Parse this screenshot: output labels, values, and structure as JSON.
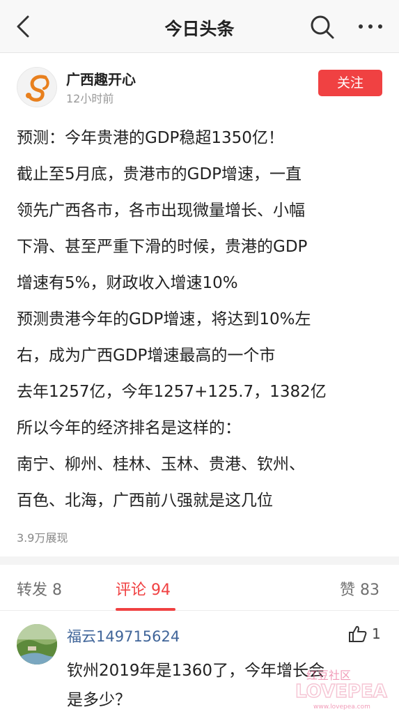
{
  "header": {
    "title": "今日头条",
    "back_icon": "chevron-left-icon",
    "search_icon": "search-icon",
    "more_icon": "more-dots-icon"
  },
  "author": {
    "name": "广西趣开心",
    "time": "12小时前",
    "follow_label": "关注",
    "avatar_icon": "squirrel-logo",
    "accent_color": "#f04142"
  },
  "article": {
    "lines": [
      "预测：今年贵港的GDP稳超1350亿！",
      "截止至5月底，贵港市的GDP增速，一直",
      "领先广西各市，各市出现微量增长、小幅",
      "下滑、甚至严重下滑的时候，贵港的GDP",
      "增速有5%，财政收入增速10%",
      "预测贵港今年的GDP增速，将达到10%左",
      "右，成为广西GDP增速最高的一个市",
      "去年1257亿，今年1257+125.7，1382亿",
      "所以今年的经济排名是这样的：",
      "南宁、柳州、桂林、玉林、贵港、钦州、",
      "百色、北海，广西前八强就是这几位"
    ],
    "views": "3.9万展现"
  },
  "tabs": {
    "repost": "转发 8",
    "comments": "评论 94",
    "likes": "赞 83",
    "active": "comments"
  },
  "comment": {
    "user": "福云149715624",
    "like_count": "1",
    "like_icon": "thumbs-up-icon",
    "text_lines": [
      "钦州2019年是1360了，今年增长会",
      "是多少？"
    ]
  },
  "watermark": {
    "line1": "红豆社区",
    "line2": "LOVEPEA",
    "line3": "www.lovepea.com"
  }
}
